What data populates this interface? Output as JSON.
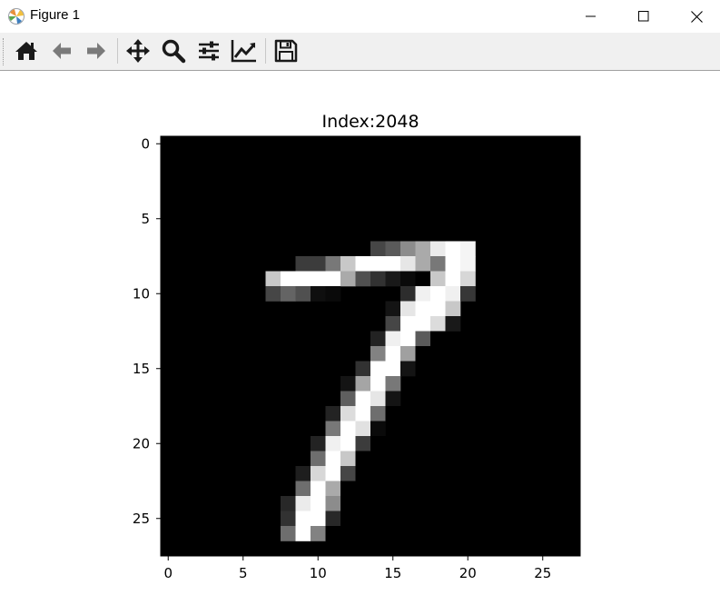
{
  "window": {
    "title": "Figure 1",
    "controls": [
      "minimize",
      "maximize",
      "close"
    ]
  },
  "toolbar": {
    "buttons": [
      {
        "icon": "home-icon",
        "action": "Home"
      },
      {
        "icon": "back-arrow-icon",
        "action": "Back"
      },
      {
        "icon": "forward-arrow-icon",
        "action": "Forward"
      },
      {
        "icon": "pan-icon",
        "action": "Pan"
      },
      {
        "icon": "zoom-icon",
        "action": "Zoom"
      },
      {
        "icon": "subplots-icon",
        "action": "Configure subplots"
      },
      {
        "icon": "edit-axis-icon",
        "action": "Edit axis"
      },
      {
        "icon": "save-icon",
        "action": "Save"
      }
    ]
  },
  "chart_data": {
    "type": "heatmap",
    "title": "Index:2048",
    "colormap": "gray",
    "xlim": [
      -0.5,
      27.5
    ],
    "ylim": [
      27.5,
      -0.5
    ],
    "xticks": [
      0,
      5,
      10,
      15,
      20,
      25
    ],
    "yticks": [
      0,
      5,
      10,
      15,
      20,
      25
    ],
    "grid": false,
    "value_range": [
      0,
      255
    ],
    "pixels": [
      {
        "row": 7,
        "cols": [
          14,
          15,
          16,
          17,
          18,
          19,
          20
        ],
        "values": [
          70,
          90,
          140,
          170,
          235,
          255,
          245
        ]
      },
      {
        "row": 8,
        "cols": [
          9,
          10,
          11,
          12,
          13,
          14,
          15,
          16,
          17,
          18,
          19,
          20
        ],
        "values": [
          60,
          60,
          120,
          200,
          255,
          255,
          255,
          230,
          170,
          120,
          255,
          245
        ]
      },
      {
        "row": 9,
        "cols": [
          7,
          8,
          9,
          10,
          11,
          12,
          13,
          14,
          15,
          16,
          17,
          18,
          19,
          20
        ],
        "values": [
          200,
          255,
          255,
          255,
          255,
          170,
          80,
          50,
          25,
          10,
          0,
          200,
          255,
          215
        ]
      },
      {
        "row": 10,
        "cols": [
          7,
          8,
          9,
          10,
          11,
          16,
          17,
          18,
          19,
          20
        ],
        "values": [
          70,
          100,
          80,
          15,
          10,
          45,
          240,
          255,
          240,
          55
        ]
      },
      {
        "row": 11,
        "cols": [
          15,
          16,
          17,
          18,
          19
        ],
        "values": [
          20,
          230,
          255,
          255,
          200
        ]
      },
      {
        "row": 12,
        "cols": [
          15,
          16,
          17,
          18,
          19
        ],
        "values": [
          70,
          255,
          255,
          220,
          25
        ]
      },
      {
        "row": 13,
        "cols": [
          14,
          15,
          16,
          17,
          18
        ],
        "values": [
          35,
          240,
          255,
          90,
          0
        ]
      },
      {
        "row": 14,
        "cols": [
          14,
          15,
          16,
          17
        ],
        "values": [
          130,
          255,
          160,
          0
        ]
      },
      {
        "row": 15,
        "cols": [
          13,
          14,
          15,
          16,
          17
        ],
        "values": [
          50,
          255,
          255,
          20,
          0
        ]
      },
      {
        "row": 16,
        "cols": [
          12,
          13,
          14,
          15
        ],
        "values": [
          20,
          165,
          255,
          120
        ]
      },
      {
        "row": 17,
        "cols": [
          12,
          13,
          14,
          15
        ],
        "values": [
          95,
          255,
          230,
          20
        ]
      },
      {
        "row": 18,
        "cols": [
          11,
          12,
          13,
          14,
          15
        ],
        "values": [
          35,
          220,
          255,
          110,
          0
        ]
      },
      {
        "row": 19,
        "cols": [
          11,
          12,
          13,
          14
        ],
        "values": [
          120,
          255,
          225,
          10
        ]
      },
      {
        "row": 20,
        "cols": [
          10,
          11,
          12,
          13,
          14
        ],
        "values": [
          35,
          240,
          255,
          60,
          0
        ]
      },
      {
        "row": 21,
        "cols": [
          10,
          11,
          12,
          13
        ],
        "values": [
          110,
          255,
          200,
          0
        ]
      },
      {
        "row": 22,
        "cols": [
          9,
          10,
          11,
          12,
          13
        ],
        "values": [
          30,
          215,
          255,
          70,
          0
        ]
      },
      {
        "row": 23,
        "cols": [
          9,
          10,
          11,
          12
        ],
        "values": [
          110,
          255,
          170,
          0
        ]
      },
      {
        "row": 24,
        "cols": [
          8,
          9,
          10,
          11,
          12
        ],
        "values": [
          40,
          235,
          255,
          140,
          0
        ]
      },
      {
        "row": 25,
        "cols": [
          8,
          9,
          10,
          11,
          12
        ],
        "values": [
          50,
          255,
          255,
          40,
          0
        ]
      },
      {
        "row": 26,
        "cols": [
          8,
          9,
          10,
          11
        ],
        "values": [
          110,
          255,
          130,
          0
        ]
      }
    ]
  }
}
